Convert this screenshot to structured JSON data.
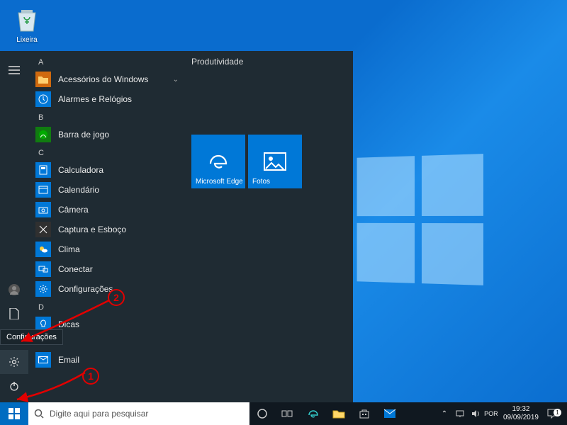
{
  "desktop": {
    "recycle_bin": "Lixeira"
  },
  "start_menu": {
    "rail_tooltip": "Configurações",
    "sections": {
      "A": [
        {
          "label": "Acessórios do Windows",
          "color": "#d06a0e",
          "expandable": true
        },
        {
          "label": "Alarmes e Relógios",
          "color": "#0078d7"
        }
      ],
      "B": [
        {
          "label": "Barra de jogo",
          "color": "#107c10"
        }
      ],
      "C": [
        {
          "label": "Calculadora",
          "color": "#0078d7"
        },
        {
          "label": "Calendário",
          "color": "#0078d7"
        },
        {
          "label": "Câmera",
          "color": "#0078d7"
        },
        {
          "label": "Captura e Esboço",
          "color": "#303030"
        },
        {
          "label": "Clima",
          "color": "#0078d7"
        },
        {
          "label": "Conectar",
          "color": "#0078d7"
        },
        {
          "label": "Configurações",
          "color": "#0078d7"
        }
      ],
      "D": [
        {
          "label": "Dicas",
          "color": "#0078d7"
        }
      ],
      "E": [
        {
          "label": "Email",
          "color": "#0078d7"
        }
      ]
    },
    "tiles_header": "Produtividade",
    "tiles": [
      {
        "label": "Microsoft Edge"
      },
      {
        "label": "Fotos"
      }
    ]
  },
  "taskbar": {
    "search_placeholder": "Digite aqui para pesquisar",
    "clock_time": "19:32",
    "clock_date": "09/09/2019",
    "notif_count": "1"
  },
  "annotations": {
    "one": "1",
    "two": "2"
  }
}
